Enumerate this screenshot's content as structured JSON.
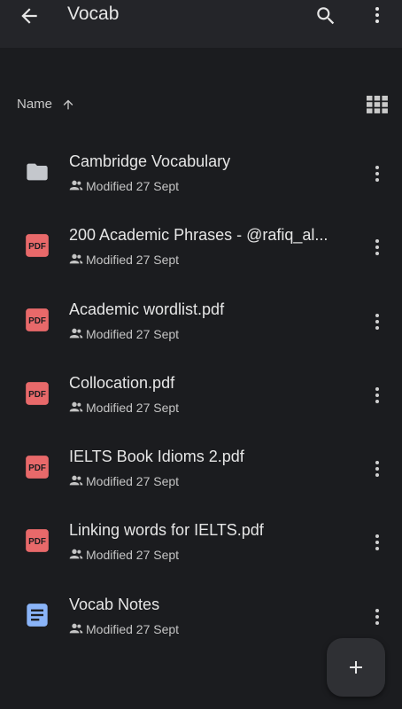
{
  "appbar": {
    "title": "Vocab",
    "back_icon": "arrow-back-icon",
    "search_icon": "search-icon",
    "more_icon": "more-vert-icon"
  },
  "sort": {
    "label": "Name",
    "direction_icon": "arrow-up-icon",
    "view_toggle_icon": "grid-view-icon"
  },
  "files": [
    {
      "name": "Cambridge Vocabulary",
      "modified": "Modified 27 Sept",
      "type": "folder"
    },
    {
      "name": "200 Academic Phrases - @rafiq_al...",
      "modified": "Modified 27 Sept",
      "type": "pdf"
    },
    {
      "name": "Academic wordlist.pdf",
      "modified": "Modified 27 Sept",
      "type": "pdf"
    },
    {
      "name": "Collocation.pdf",
      "modified": "Modified 27 Sept",
      "type": "pdf"
    },
    {
      "name": "IELTS Book Idioms 2.pdf",
      "modified": "Modified 27 Sept",
      "type": "pdf"
    },
    {
      "name": "Linking words for IELTS.pdf",
      "modified": "Modified 27 Sept",
      "type": "pdf"
    },
    {
      "name": "Vocab Notes",
      "modified": "Modified 27 Sept",
      "type": "doc"
    }
  ],
  "pdf_badge": "PDF",
  "fab_icon": "plus-icon",
  "colors": {
    "background": "#1b1c1f",
    "appbar": "#242529",
    "pdf_red": "#e8696a",
    "doc_blue": "#8ab4f8",
    "folder_gray": "#c4c7cc"
  }
}
